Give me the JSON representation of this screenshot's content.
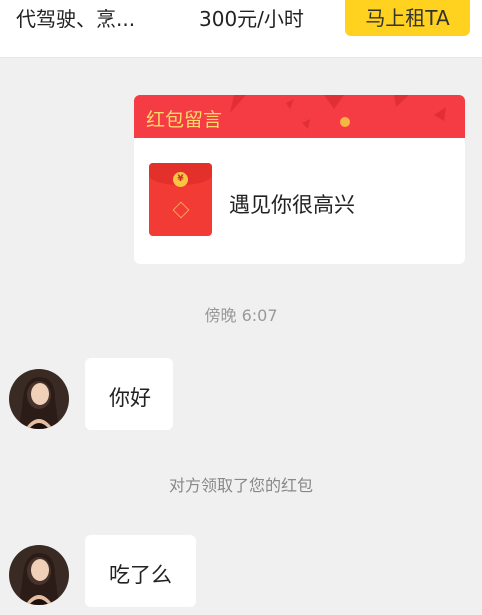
{
  "header": {
    "service": "代驾驶、烹...",
    "price": "300元/小时",
    "rent_button": "马上租TA"
  },
  "colors": {
    "accent_yellow": "#ffd21f",
    "red_envelope": "#f53b43",
    "card_title_gold": "#ffd86a",
    "background": "#f0f0f0"
  },
  "red_envelope_card": {
    "title": "红包留言",
    "message": "遇见你很高兴",
    "coin_symbol": "¥"
  },
  "conversation": {
    "time_stamp": "傍晚 6:07",
    "system_notice": "对方领取了您的红包",
    "messages": [
      {
        "text": "你好",
        "avatar_icon": "user-avatar"
      },
      {
        "text": "吃了么",
        "avatar_icon": "user-avatar"
      }
    ]
  }
}
